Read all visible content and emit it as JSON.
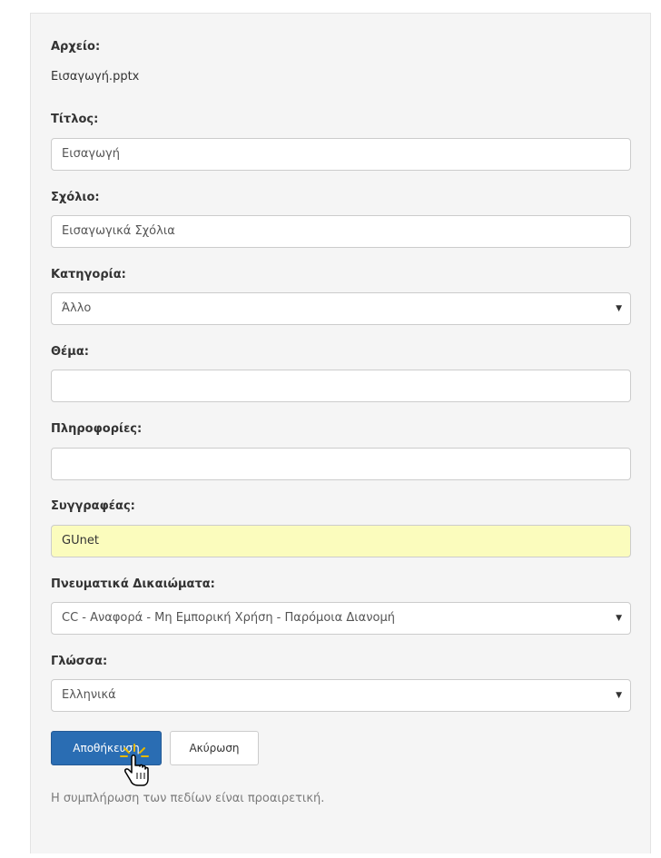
{
  "form": {
    "file": {
      "label": "Αρχείο:",
      "value": "Εισαγωγή.pptx"
    },
    "title": {
      "label": "Τίτλος:",
      "value": "Εισαγωγή"
    },
    "comment": {
      "label": "Σχόλιο:",
      "value": "Εισαγωγικά Σχόλια"
    },
    "category": {
      "label": "Κατηγορία:",
      "selected": "Άλλο"
    },
    "subject": {
      "label": "Θέμα:",
      "value": ""
    },
    "info": {
      "label": "Πληροφορίες:",
      "value": ""
    },
    "author": {
      "label": "Συγγραφέας:",
      "value": "GUnet"
    },
    "copyright": {
      "label": "Πνευματικά Δικαιώματα:",
      "selected": "CC - Αναφορά - Μη Εμπορική Χρήση - Παρόμοια Διανομή"
    },
    "language": {
      "label": "Γλώσσα:",
      "selected": "Ελληνικά"
    }
  },
  "buttons": {
    "save_label": "Αποθήκευση",
    "cancel_label": "Ακύρωση"
  },
  "hint": "Η συμπλήρωση των πεδίων είναι προαιρετική.",
  "icons": {
    "select_caret": "chevron-down-icon",
    "cursor": "hand-pointer-icon"
  },
  "colors": {
    "panel_background": "#f5f5f5",
    "primary_button": "#2a6db3",
    "highlighted_field": "#fbfcbd",
    "hint_text": "#7a7a7a"
  }
}
